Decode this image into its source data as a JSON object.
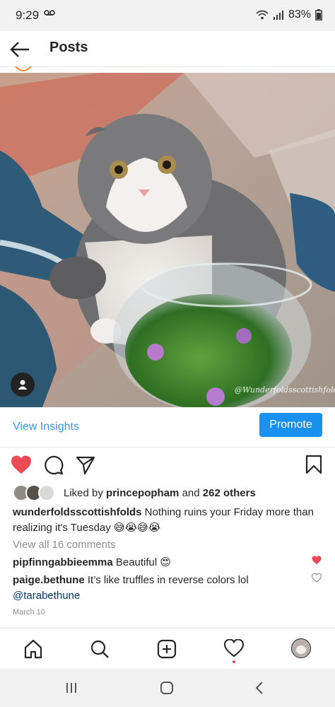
{
  "status_bar": {
    "time": "9:29",
    "battery": "83%"
  },
  "app_bar": {
    "title": "Posts"
  },
  "post": {
    "watermark": "@Wunderfoldsscottishfolds",
    "view_insights": "View Insights",
    "promote": "Promote",
    "liked_prefix": "Liked by ",
    "liked_user": "princepopham",
    "liked_and": " and ",
    "liked_others": "262 others",
    "caption_user": "wunderfoldsscottishfolds",
    "caption_text": " Nothing ruins your Friday more than realizing it's Tuesday 😅😭😅😭",
    "view_all_comments": "View all 16 comments",
    "comments": [
      {
        "user": "pipfinngabbieemma",
        "text": " Beautiful 😍",
        "liked": true
      },
      {
        "user": "paige.bethune",
        "text": " It’s like truffles in reverse colors lol",
        "mention": "@tarabethune",
        "liked": false
      }
    ],
    "date": "March 10"
  },
  "colors": {
    "accent": "#3897f0",
    "like_red": "#ed4956",
    "promote_bg": "#1a91f0"
  },
  "icons": [
    "back-arrow-icon",
    "wifi-icon",
    "signal-icon",
    "battery-icon",
    "heart-icon",
    "comment-icon",
    "share-icon",
    "bookmark-icon",
    "home-icon",
    "search-icon",
    "add-icon",
    "activity-icon",
    "profile-icon",
    "user-icon"
  ]
}
